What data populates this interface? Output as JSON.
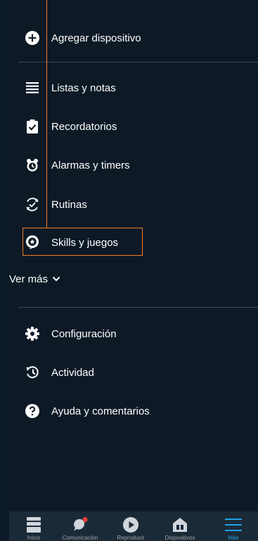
{
  "menu": {
    "add_device": "Agregar dispositivo",
    "lists": "Listas y notas",
    "reminders": "Recordatorios",
    "alarms": "Alarmas y timers",
    "routines": "Rutinas",
    "skills": "Skills y juegos",
    "see_more": "Ver más",
    "settings": "Configuración",
    "activity": "Actividad",
    "help": "Ayuda y comentarios"
  },
  "tabs": [
    {
      "label": "Inicio",
      "icon": "home-icon"
    },
    {
      "label": "Comunicación",
      "icon": "chat-bubble-icon"
    },
    {
      "label": "Reproducir",
      "icon": "play-icon"
    },
    {
      "label": "Dispositivos",
      "icon": "devices-icon"
    },
    {
      "label": "Más",
      "icon": "hamburger-menu-icon"
    }
  ],
  "colors": {
    "background": "#0d1a26",
    "accent": "#1da1e6",
    "highlight": "#f07b28",
    "notification": "#e8413c"
  }
}
